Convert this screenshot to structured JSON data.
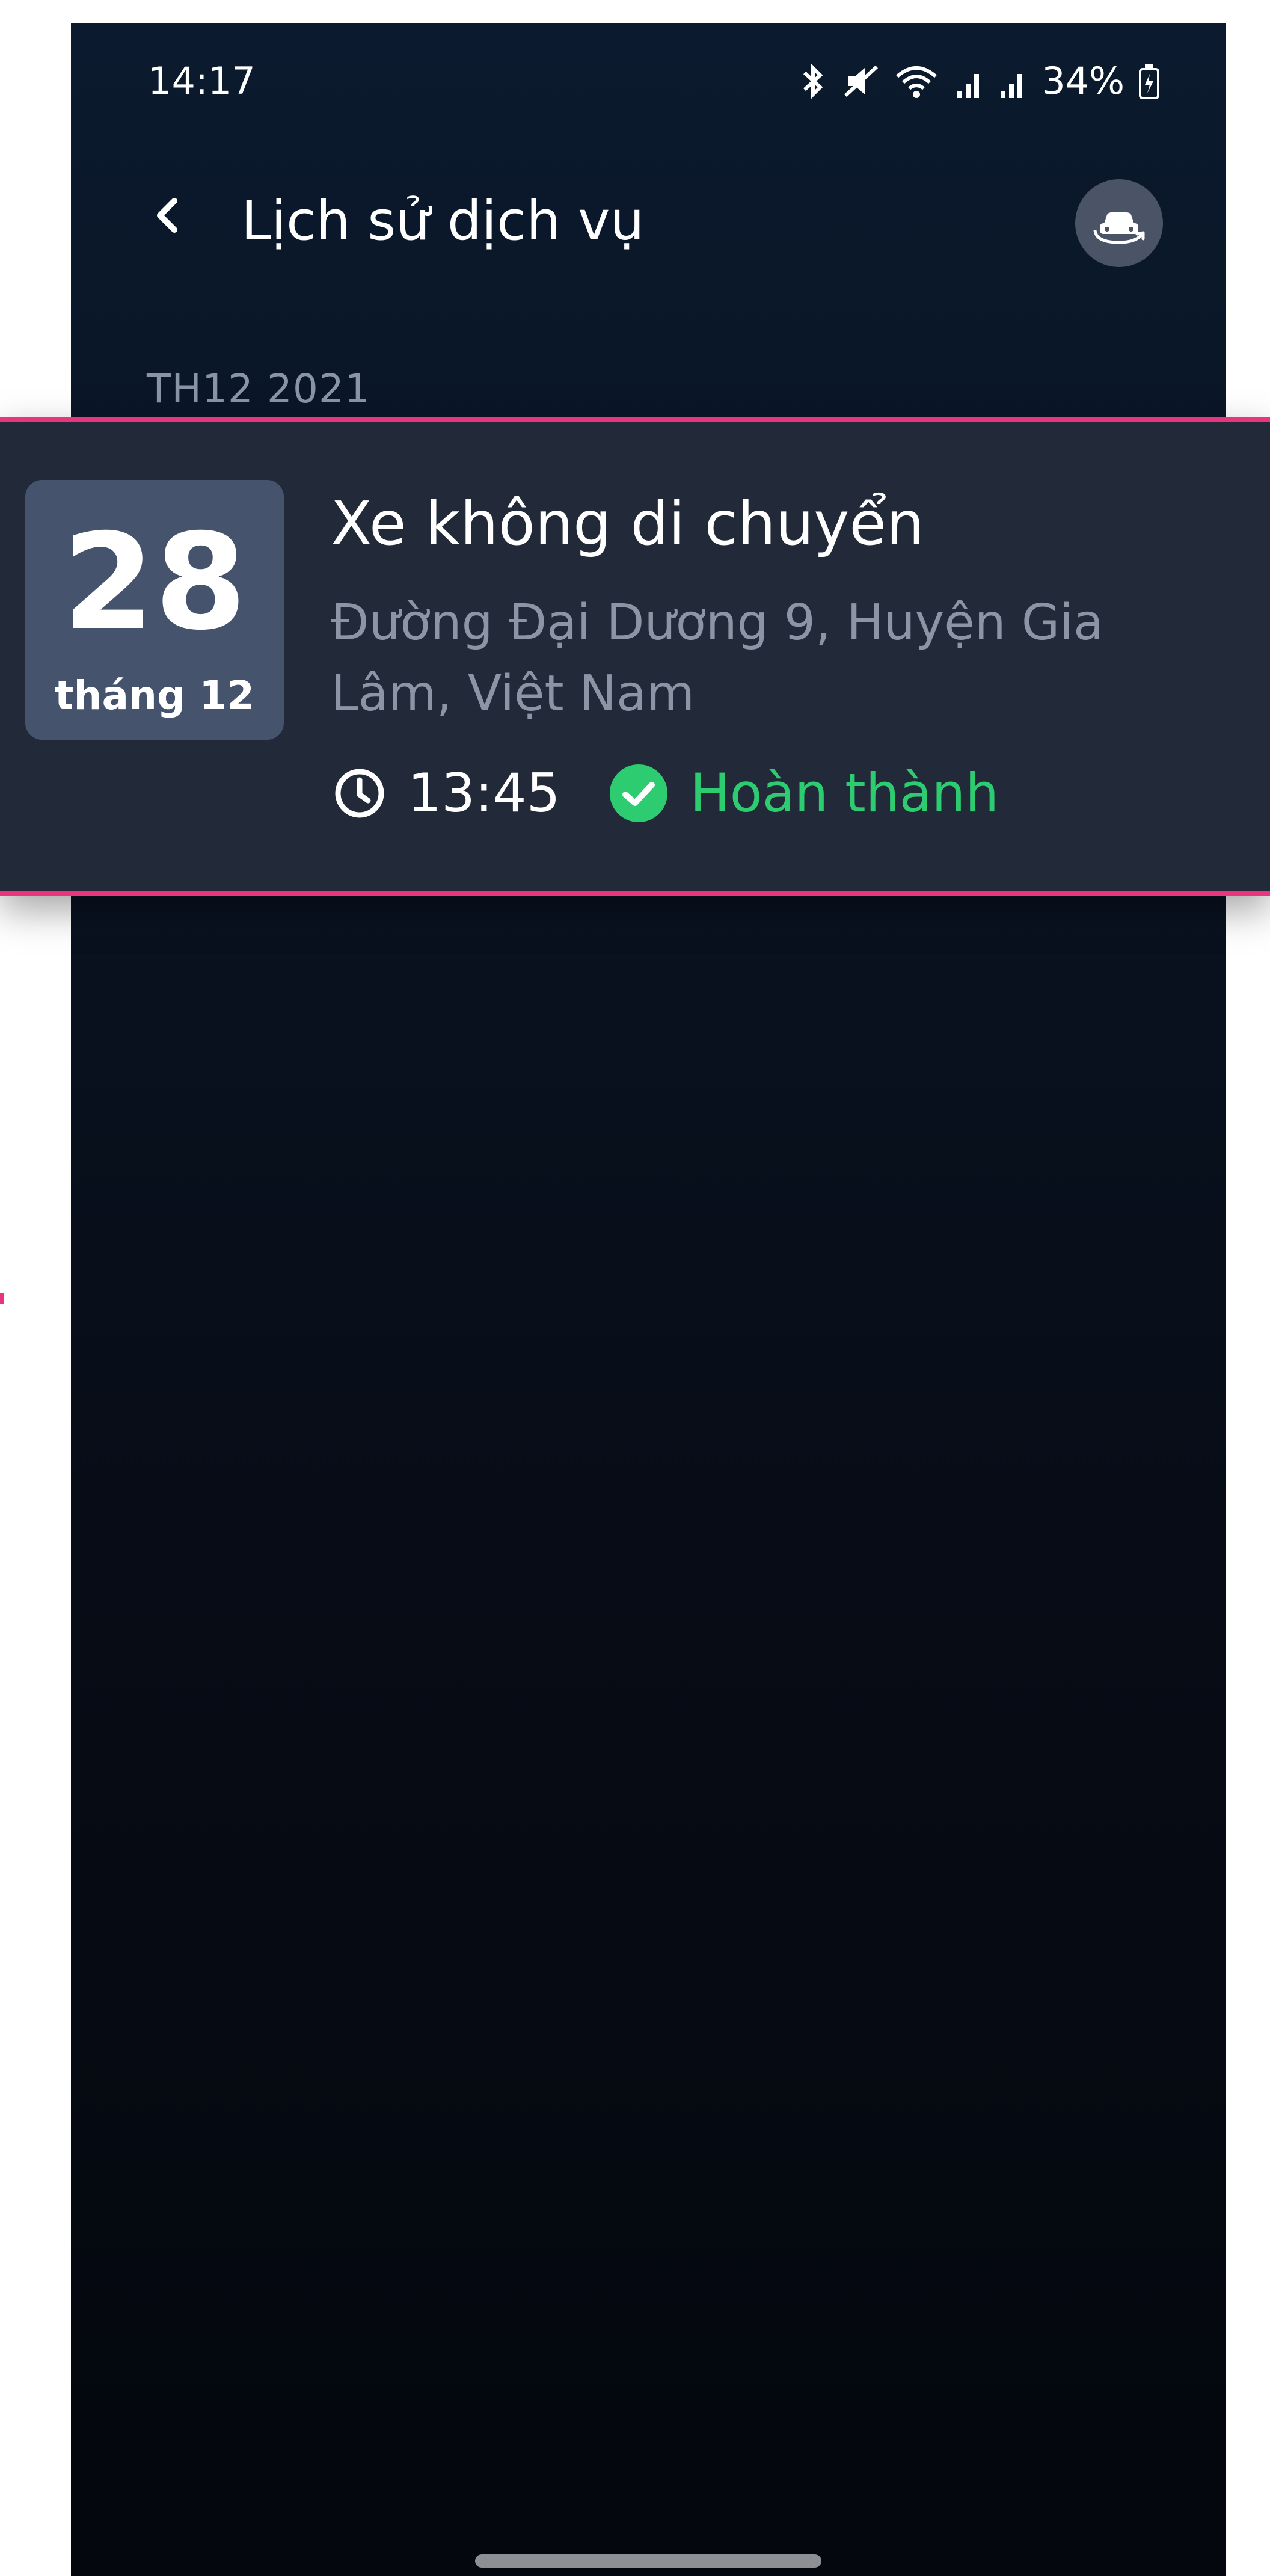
{
  "status_bar": {
    "time": "14:17",
    "battery": "34%",
    "icons": [
      "bluetooth-icon",
      "mute-icon",
      "wifi-icon",
      "signal-icon",
      "signal-icon",
      "battery-charging-icon"
    ]
  },
  "app_bar": {
    "back_icon": "chevron-left-icon",
    "title": "Lịch sử dịch vụ",
    "action_icon": "car-swap-icon"
  },
  "section": {
    "header": "TH12 2021"
  },
  "service": {
    "day": "28",
    "month": "tháng 12",
    "title": "Xe không di chuyển",
    "address": "Đường Đại Dương 9, Huyện Gia Lâm, Việt Nam",
    "time": "13:45",
    "status": "Hoàn thành",
    "status_color": "#2ecc71",
    "highlight_color": "#e8357d"
  }
}
